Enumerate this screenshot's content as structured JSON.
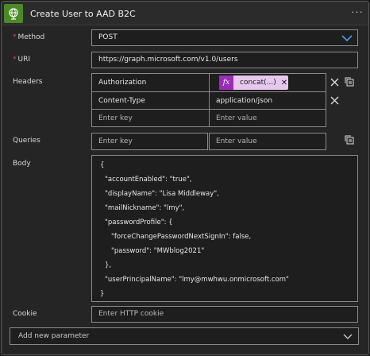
{
  "card": {
    "title": "Create User to AAD B2C",
    "more_label": "···"
  },
  "labels": {
    "method": "Method",
    "uri": "URI",
    "headers": "Headers",
    "queries": "Queries",
    "body": "Body",
    "cookie": "Cookie",
    "required_mark": "*"
  },
  "method": {
    "value": "POST"
  },
  "uri": {
    "value": "https://graph.microsoft.com/v1.0/users"
  },
  "headers": {
    "rows": [
      {
        "key": "Authorization",
        "value_token": {
          "fx": "fx",
          "text": "concat(...)",
          "remove": "✕"
        }
      },
      {
        "key": "Content-Type",
        "value": "application/json"
      }
    ],
    "key_placeholder": "Enter key",
    "value_placeholder": "Enter value"
  },
  "queries": {
    "key_placeholder": "Enter key",
    "value_placeholder": "Enter value"
  },
  "body": {
    "lines": [
      "{",
      "\"accountEnabled\": \"true\",",
      "\"displayName\": \"Lisa Middleway\",",
      "\"mailNickname\": \"lmy\",",
      "\"passwordProfile\": {",
      "\"forceChangePasswordNextSignIn\": false,",
      "\"password\": \"MWblog2021\"",
      "},",
      "\"userPrincipalName\": \"lmy@mwhwu.onmicrosoft.com\"",
      "}"
    ]
  },
  "cookie": {
    "placeholder": "Enter HTTP cookie"
  },
  "add_param": {
    "label": "Add new parameter"
  },
  "colors": {
    "accent": "#4a9eea",
    "token_bg": "#e6c8ef",
    "token_fx": "#9b2bb8",
    "required": "#e0443b",
    "title_icon": "#4a8b27"
  }
}
